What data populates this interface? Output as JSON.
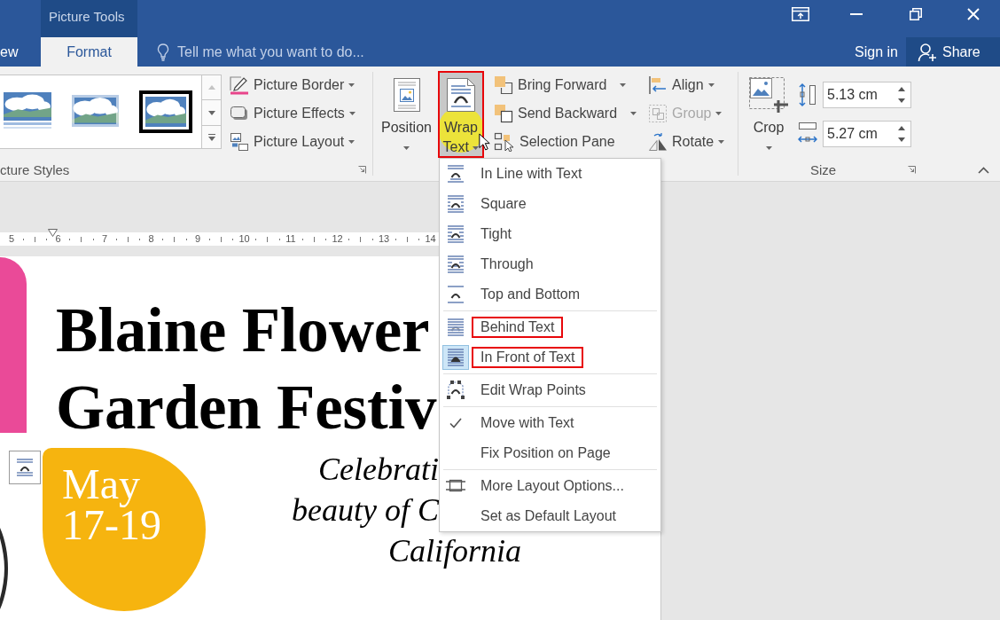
{
  "title_bar": {
    "context_tab": "Picture Tools"
  },
  "tabs": [
    {
      "label": "ew",
      "selected": false
    },
    {
      "label": "Format",
      "selected": true
    }
  ],
  "tell_me": {
    "placeholder": "Tell me what you want to do..."
  },
  "account": {
    "sign_in": "Sign in",
    "share": "Share"
  },
  "picture_styles": {
    "label": "cture Styles",
    "gallery": [
      {
        "kind": "reflected"
      },
      {
        "kind": "soft"
      },
      {
        "kind": "framed"
      }
    ],
    "commands": [
      {
        "label": "Picture Border",
        "kind": "menu"
      },
      {
        "label": "Picture Effects",
        "kind": "menu"
      },
      {
        "label": "Picture Layout",
        "kind": "menu"
      }
    ]
  },
  "arrange": {
    "large": [
      {
        "label": "Position",
        "pressed": false,
        "hovered": false,
        "annotated": false
      },
      {
        "label": "Wrap Text",
        "pressed": true,
        "hovered": true,
        "annotated": true
      }
    ],
    "columns": [
      {
        "items": [
          {
            "label": "Bring Forward",
            "kind": "split",
            "disabled": false
          },
          {
            "label": "Send Backward",
            "kind": "split",
            "disabled": false
          },
          {
            "label": "Selection Pane",
            "kind": "plain",
            "disabled": false
          }
        ]
      },
      {
        "items": [
          {
            "label": "Align",
            "kind": "menu",
            "disabled": false
          },
          {
            "label": "Group",
            "kind": "menu",
            "disabled": true
          },
          {
            "label": "Rotate",
            "kind": "menu",
            "disabled": false
          }
        ]
      }
    ]
  },
  "size": {
    "label": "Size",
    "crop": "Crop",
    "height": "5.13 cm",
    "width": "5.27 cm"
  },
  "document": {
    "ruler": [
      "5",
      "6",
      "7",
      "8",
      "9",
      "10",
      "11",
      "12",
      "13",
      "14"
    ],
    "title_lines": [
      "Blaine Flower",
      "Garden Festiv"
    ],
    "badge_lines": [
      "May",
      "17-19"
    ],
    "tagline_lines": [
      "Celebrati",
      "beauty of C",
      "California"
    ]
  },
  "wrap_menu": {
    "sections": [
      {
        "items": [
          {
            "kind": "wrap",
            "label": "In Line with Text",
            "selected": false,
            "annotated": false
          },
          {
            "kind": "wrap",
            "label": "Square",
            "selected": false,
            "annotated": false
          },
          {
            "kind": "wrap",
            "label": "Tight",
            "selected": false,
            "annotated": false
          },
          {
            "kind": "wrap",
            "label": "Through",
            "selected": false,
            "annotated": false
          },
          {
            "kind": "wrap",
            "label": "Top and Bottom",
            "selected": false,
            "annotated": false
          }
        ]
      },
      {
        "items": [
          {
            "kind": "wrap",
            "label": "Behind Text",
            "selected": false,
            "annotated": true
          },
          {
            "kind": "wrap",
            "label": "In Front of Text",
            "selected": true,
            "annotated": true
          }
        ]
      },
      {
        "items": [
          {
            "kind": "command",
            "label": "Edit Wrap Points"
          }
        ]
      },
      {
        "items": [
          {
            "kind": "toggle",
            "label": "Move with Text",
            "checked": true
          },
          {
            "kind": "toggle",
            "label": "Fix Position on Page",
            "checked": false
          }
        ]
      },
      {
        "items": [
          {
            "kind": "command",
            "label": "More Layout Options..."
          },
          {
            "kind": "command",
            "label": "Set as Default Layout"
          }
        ]
      }
    ]
  }
}
